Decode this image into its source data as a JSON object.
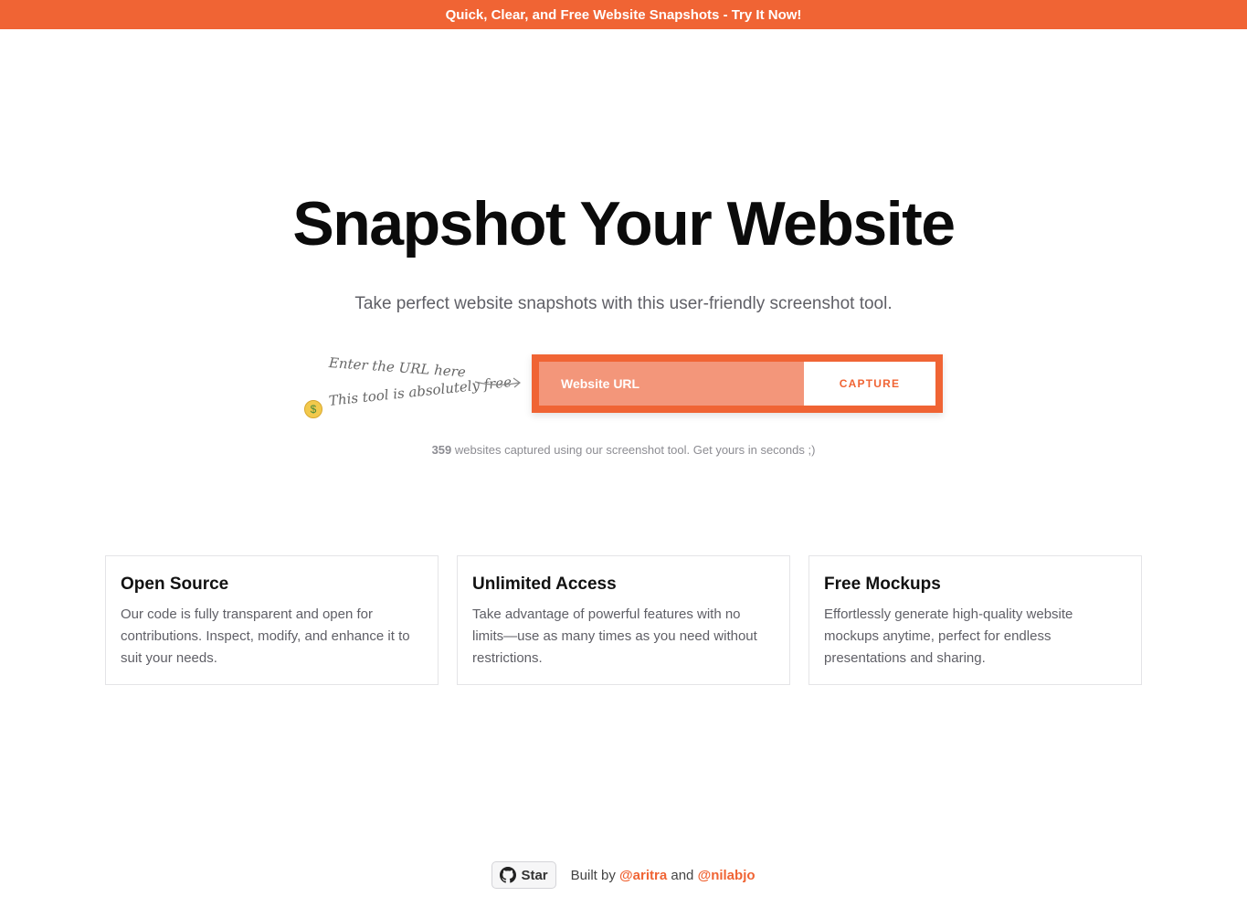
{
  "banner": {
    "text": "Quick, Clear, and Free Website Snapshots - Try It Now!"
  },
  "hero": {
    "title": "Snapshot Your Website",
    "subtitle": "Take perfect website snapshots with this user-friendly screenshot tool."
  },
  "hints": {
    "enter_url": "Enter the URL here",
    "free": "This tool is absolutely free"
  },
  "capture": {
    "placeholder": "Website URL",
    "button_label": "CAPTURE"
  },
  "stats": {
    "count": "359",
    "text": " websites captured using our screenshot tool. Get yours in seconds ;)"
  },
  "features": [
    {
      "title": "Open Source",
      "description": "Our code is fully transparent and open for contributions. Inspect, modify, and enhance it to suit your needs."
    },
    {
      "title": "Unlimited Access",
      "description": "Take advantage of powerful features with no limits—use as many times as you need without restrictions."
    },
    {
      "title": "Free Mockups",
      "description": "Effortlessly generate high-quality website mockups anytime, perfect for endless presentations and sharing."
    }
  ],
  "footer": {
    "star_label": "Star",
    "built_by": "Built by",
    "author1": "@aritra",
    "and": "and",
    "author2": "@nilabjo"
  },
  "colors": {
    "accent": "#f06434",
    "input_bg": "#f3967a"
  },
  "icons": {
    "github": "github-icon",
    "emoji": "money-mouth-face-icon",
    "arrow": "arrow-right-icon"
  }
}
